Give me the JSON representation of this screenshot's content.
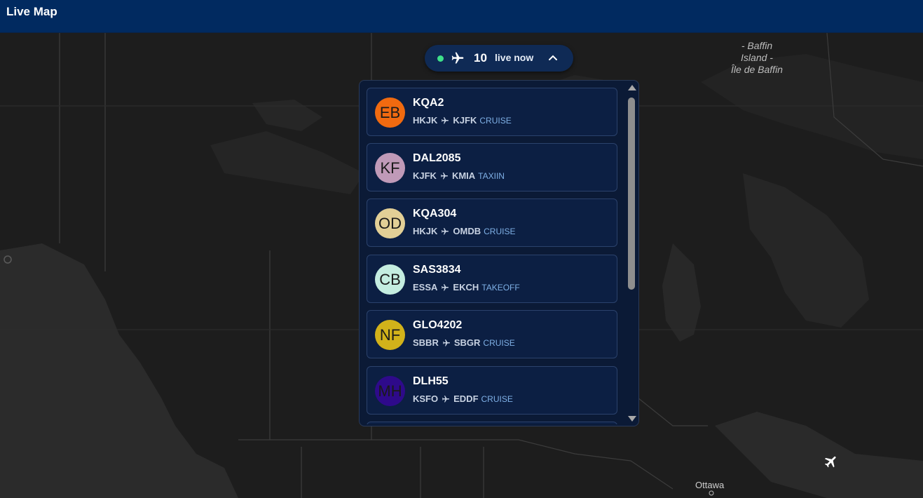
{
  "header": {
    "title": "Live Map"
  },
  "live_pill": {
    "count": "10",
    "label": "live now",
    "status_color": "#3ee08a"
  },
  "map": {
    "labels": [
      {
        "text": "- Baffin\nIsland -\nÎle de Baffin"
      }
    ],
    "city": {
      "name": "Ottawa"
    }
  },
  "flights": [
    {
      "initials": "EB",
      "avatar_color": "#f06a10",
      "callsign": "KQA2",
      "from": "HKJK",
      "to": "KJFK",
      "phase": "CRUISE"
    },
    {
      "initials": "KF",
      "avatar_color": "#c09ab8",
      "callsign": "DAL2085",
      "from": "KJFK",
      "to": "KMIA",
      "phase": "TAXIIN"
    },
    {
      "initials": "OD",
      "avatar_color": "#e2cf96",
      "callsign": "KQA304",
      "from": "HKJK",
      "to": "OMDB",
      "phase": "CRUISE"
    },
    {
      "initials": "CB",
      "avatar_color": "#c4ede0",
      "callsign": "SAS3834",
      "from": "ESSA",
      "to": "EKCH",
      "phase": "TAKEOFF"
    },
    {
      "initials": "NF",
      "avatar_color": "#d2b21a",
      "callsign": "GLO4202",
      "from": "SBBR",
      "to": "SBGR",
      "phase": "CRUISE"
    },
    {
      "initials": "MH",
      "avatar_color": "#2e0a8a",
      "callsign": "DLH55",
      "from": "KSFO",
      "to": "EDDF",
      "phase": "CRUISE"
    }
  ]
}
